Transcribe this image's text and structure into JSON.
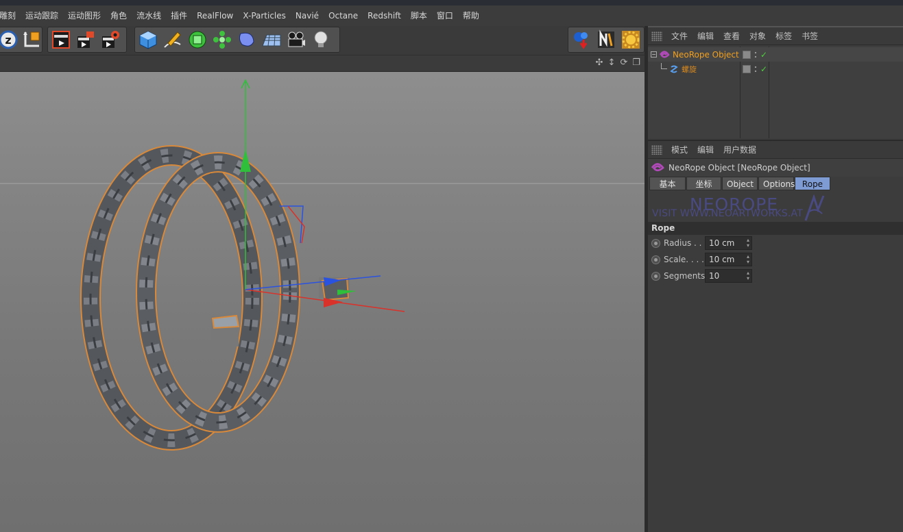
{
  "menubar": {
    "items": [
      "雕刻",
      "运动跟踪",
      "运动图形",
      "角色",
      "流水线",
      "插件",
      "RealFlow",
      "X-Particles",
      "Navié",
      "Octane",
      "Redshift",
      "脚本",
      "窗口",
      "帮助"
    ]
  },
  "toolbar": {
    "groups": [
      [
        "z-axis-lock-icon",
        "world-coordinates-icon"
      ],
      [
        "render-view-icon",
        "render-to-picture-viewer-icon",
        "render-settings-icon"
      ],
      [
        "cube-primitive-icon",
        "pen-spline-icon",
        "subdivision-surface-icon",
        "array-cloner-icon",
        "deformer-icon",
        "floor-scene-icon",
        "camera-icon",
        "light-icon"
      ],
      [
        "xparticles-icon",
        "neoartworks-icon",
        "settings-sun-icon"
      ]
    ]
  },
  "object_manager": {
    "menu": [
      "文件",
      "编辑",
      "查看",
      "对象",
      "标签",
      "书签"
    ],
    "objects": [
      {
        "name": "NeoRope Object",
        "selected": true
      },
      {
        "name": "螺旋",
        "selected": false
      }
    ]
  },
  "attribute_manager": {
    "menu": [
      "模式",
      "编辑",
      "用户数据"
    ],
    "title": "NeoRope Object [NeoRope Object]",
    "tabs": [
      "基本",
      "坐标",
      "Object",
      "Options",
      "Rope"
    ],
    "active_tab": "Rope",
    "banner": {
      "big": "NEOROPE",
      "small": "VISIT WWW.NEOARTWORKS.AT"
    },
    "section": "Rope",
    "params": [
      {
        "label": "Radius . .",
        "value": "10 cm"
      },
      {
        "label": "Scale. . . .",
        "value": "10 cm"
      },
      {
        "label": "Segments",
        "value": "10"
      }
    ]
  },
  "colors": {
    "accent_tab": "#7e9bd3",
    "selected_object": "#f0a020",
    "check": "#4cd23c",
    "axis_x": "#d8322a",
    "axis_y": "#2fbf3a",
    "axis_z": "#2a52e0",
    "rope_outline": "#d9893a"
  }
}
